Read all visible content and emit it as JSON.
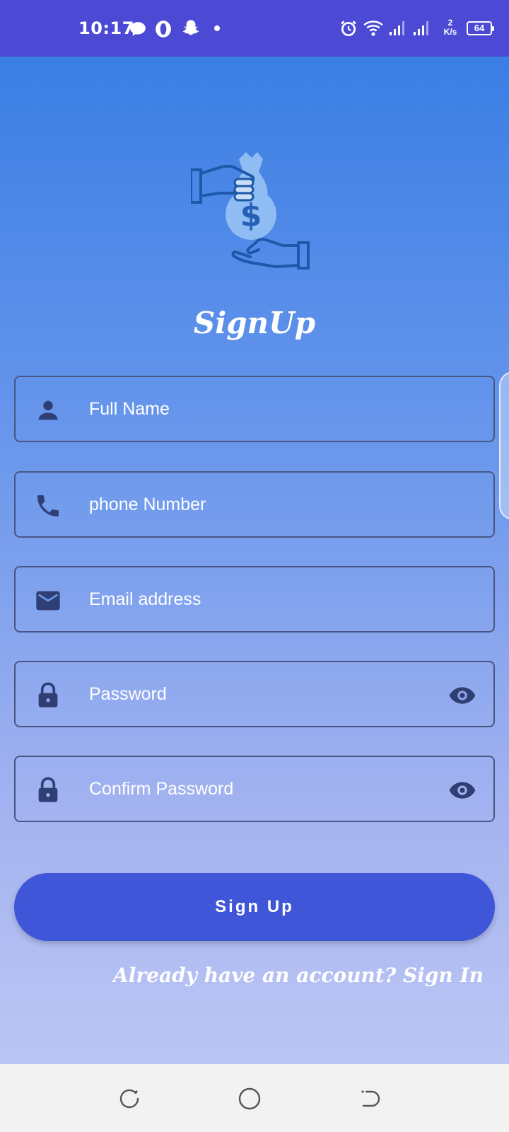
{
  "status_bar": {
    "time": "10:17",
    "net_speed_value": "2",
    "net_speed_unit": "K/s",
    "battery": "64",
    "icons": [
      "message-icon",
      "opera-icon",
      "snapchat-icon",
      "dot-icon",
      "alarm-icon",
      "wifi-icon",
      "signal-icon",
      "signal-icon-2"
    ]
  },
  "app": {
    "title": "SignUp",
    "logo_icon": "money-exchange-icon",
    "fields": {
      "full_name": {
        "placeholder": "Full Name",
        "icon": "person-icon"
      },
      "phone": {
        "placeholder": "phone Number",
        "icon": "phone-icon"
      },
      "email": {
        "placeholder": "Email address",
        "icon": "email-icon"
      },
      "password": {
        "placeholder": "Password",
        "icon": "lock-icon",
        "toggle_icon": "eye-icon"
      },
      "confirm_password": {
        "placeholder": "Confirm Password",
        "icon": "lock-icon",
        "toggle_icon": "eye-icon"
      }
    },
    "signup_button": "Sign Up",
    "signin_link": "Already have an account? Sign In"
  },
  "colors": {
    "status_bar": "#4c4ad4",
    "gradient_top": "#3a7ee4",
    "gradient_bottom": "#bcc6f4",
    "button": "#3f56d8",
    "icon_dark": "#2f3f74"
  },
  "nav_bar": {
    "buttons": [
      "recents-icon",
      "home-icon",
      "back-icon"
    ]
  }
}
